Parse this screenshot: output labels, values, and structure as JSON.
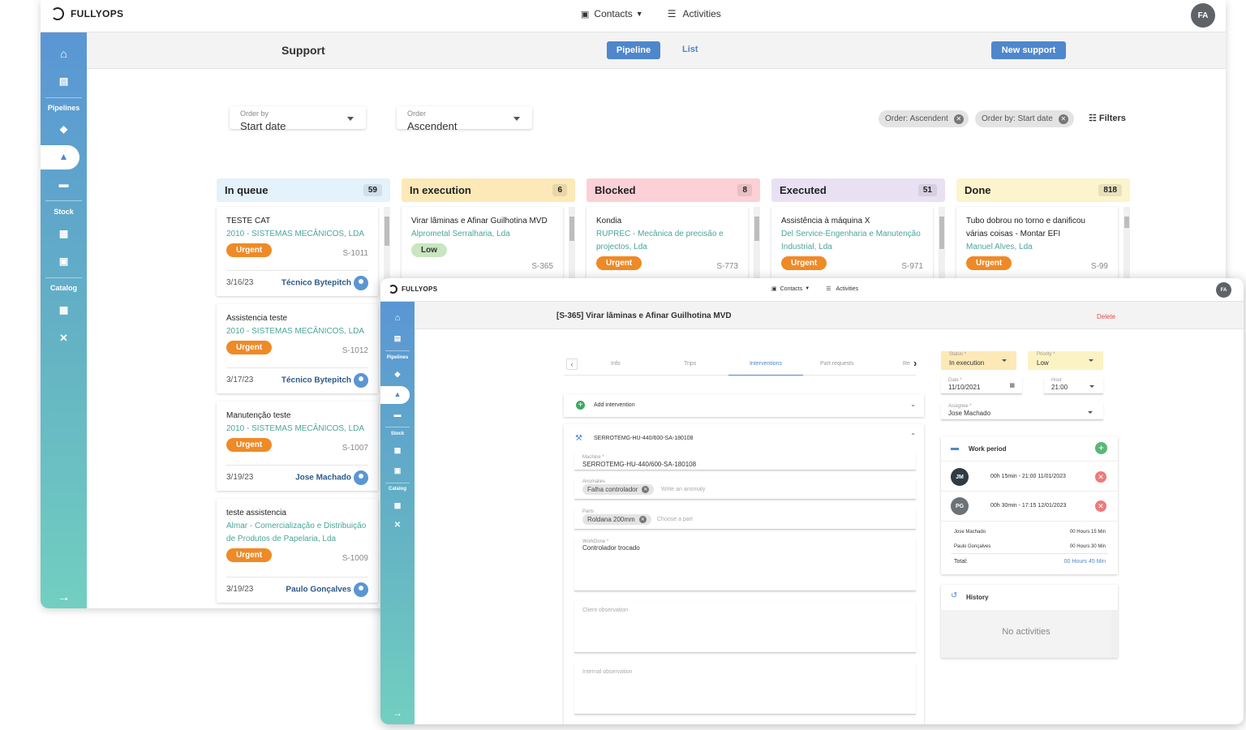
{
  "app": {
    "name": "FULLYOPS",
    "user_initials": "FA"
  },
  "nav": {
    "contacts": "Contacts",
    "activities": "Activities"
  },
  "sidebar": {
    "pipelines": "Pipelines",
    "stock": "Stock",
    "catalog": "Catalog"
  },
  "support": {
    "title": "Support",
    "tab_pipeline": "Pipeline",
    "tab_list": "List",
    "new_button": "New support",
    "order_by_label": "Order by",
    "order_by_value": "Start date",
    "order_label": "Order",
    "order_value": "Ascendent",
    "chip1": "Order: Ascendent",
    "chip2": "Order by: Start date",
    "filters": "Filters"
  },
  "columns": [
    {
      "title": "In queue",
      "count": "59",
      "color": "#e3f2fb"
    },
    {
      "title": "In execution",
      "count": "6",
      "color": "#fce9b7"
    },
    {
      "title": "Blocked",
      "count": "8",
      "color": "#fbd0d6"
    },
    {
      "title": "Executed",
      "count": "51",
      "color": "#e9e1f3"
    },
    {
      "title": "Done",
      "count": "818",
      "color": "#fbf4cc"
    }
  ],
  "queue_cards": [
    {
      "title": "TESTE CAT",
      "client": "2010 - SISTEMAS MECÂNICOS, LDA",
      "badge": "Urgent",
      "id": "S-1011",
      "date": "3/16/23",
      "user": "Técnico Bytepitch"
    },
    {
      "title": "Assistencia teste",
      "client": "2010 - SISTEMAS MECÂNICOS, LDA",
      "badge": "Urgent",
      "id": "S-1012",
      "date": "3/17/23",
      "user": "Técnico Bytepitch"
    },
    {
      "title": "Manutenção teste",
      "client": "2010 - SISTEMAS MECÂNICOS, LDA",
      "badge": "Urgent",
      "id": "S-1007",
      "date": "3/19/23",
      "user": "Jose Machado"
    },
    {
      "title": "teste assistencia",
      "client": "Almar - Comercialização e Distribuição de Produtos de Papelaria, Lda",
      "badge": "Urgent",
      "id": "S-1009",
      "date": "3/19/23",
      "user": "Paulo Gonçalves"
    }
  ],
  "other_cards": [
    {
      "title": "Virar lâminas e Afinar Guilhotina MVD",
      "client": "Alprometal Serralharia, Lda",
      "badge": "Low",
      "id": "S-365"
    },
    {
      "title": "Kondia",
      "client": "RUPREC - Mecânica de precisão e projectos, Lda",
      "badge": "Urgent",
      "id": "S-773"
    },
    {
      "title": "Assistência à máquina X",
      "client": "Del Service-Engenharia e Manutenção Industrial, Lda",
      "badge": "Urgent",
      "id": "S-971"
    },
    {
      "title": "Tubo dobrou no torno e danificou várias coisas - Montar EFI",
      "client": "Manuel Alves, Lda",
      "badge": "Urgent",
      "id": "S-99"
    }
  ],
  "detail": {
    "title": "[S-365] Virar lâminas e Afinar Guilhotina MVD",
    "delete": "Delete",
    "tabs": [
      "Info",
      "Trips",
      "Interventions",
      "Part requests",
      "Re"
    ],
    "add_intervention": "Add intervention",
    "intervention_title": "SERROTEMG-HU-440/600-SA-180108",
    "machine_label": "Machine *",
    "machine_value": "SERROTEMG-HU-440/600-SA-180108",
    "anomalies_label": "Anomalies",
    "anomaly_chip": "Falha controlador",
    "anomaly_placeholder": "Write an anomaly",
    "parts_label": "Parts",
    "part_chip": "Roldana 200mm",
    "part_placeholder": "Choose a part",
    "workdone_label": "WorkDone *",
    "workdone_value": "Controlador trocado",
    "client_obs": "Client observation",
    "internal_obs": "Internal observation",
    "status_label": "Status *",
    "status_value": "In execution",
    "priority_label": "Priority *",
    "priority_value": "Low",
    "date_label": "Date *",
    "date_value": "11/10/2021",
    "hour_label": "Hour",
    "hour_value": "21:00",
    "assignee_label": "Assignee *",
    "assignee_value": "Jose Machado",
    "work_period": "Work period",
    "periods": [
      {
        "initials": "JM",
        "text": "00h 15min - 21:00 11/01/2023",
        "color": "#2f3a44"
      },
      {
        "initials": "PG",
        "text": "00h 30min - 17:15 12/01/2023",
        "color": "#6b7278"
      }
    ],
    "summary": [
      {
        "name": "Jose Machado",
        "value": "00 Hours 15 Min"
      },
      {
        "name": "Paulo Gonçalves",
        "value": "00 Hours 30 Min"
      }
    ],
    "total_label": "Total:",
    "total_value": "00 Hours 45 Min",
    "history": "History",
    "no_activities": "No activities"
  }
}
